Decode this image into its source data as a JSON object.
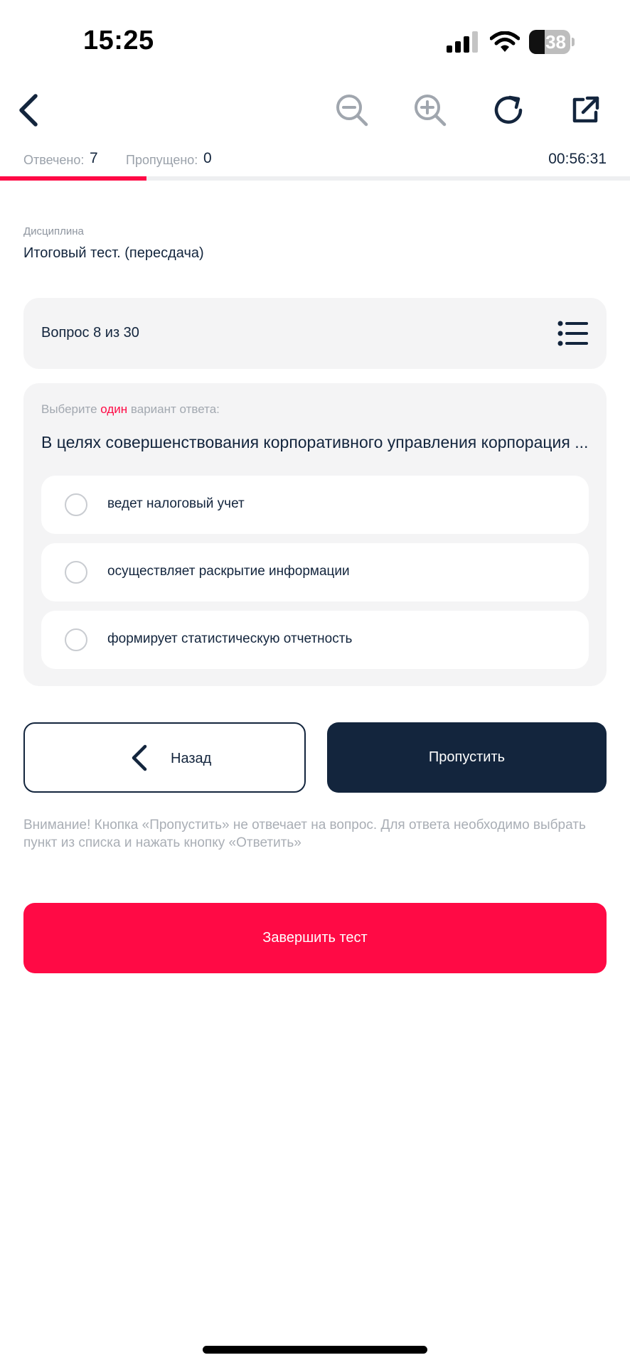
{
  "status_bar": {
    "time": "15:25",
    "battery_level": "38",
    "battery_fraction": 0.38,
    "icons": [
      "cellular-signal-icon",
      "wifi-icon",
      "battery-icon"
    ]
  },
  "toolbar": {
    "icons": [
      "back-chevron-icon",
      "zoom-out-icon",
      "zoom-in-icon",
      "refresh-icon",
      "external-link-icon"
    ]
  },
  "stats": {
    "answered_label": "Отвечено:",
    "answered_value": "7",
    "skipped_label": "Пропущено:",
    "skipped_value": "0",
    "timer": "00:56:31"
  },
  "progress": {
    "fraction": 0.233
  },
  "discipline": {
    "label": "Дисциплина",
    "value": "Итоговый тест. (пересдача)"
  },
  "question": {
    "counter": "Вопрос 8 из 30",
    "instruction_prefix": "Выберите ",
    "instruction_accent": "один",
    "instruction_suffix": " вариант ответа:",
    "text": "В целях совершенствования корпоративного управления корпорация ...",
    "options": [
      {
        "label": "ведет налоговый учет",
        "selected": false
      },
      {
        "label": "осуществляет раскрытие информации",
        "selected": false
      },
      {
        "label": "формирует статистическую отчетность",
        "selected": false
      }
    ]
  },
  "buttons": {
    "back": "Назад",
    "skip": "Пропустить",
    "finish": "Завершить тест"
  },
  "notice": "Внимание! Кнопка «Пропустить» не отвечает на вопрос. Для ответа необходимо выбрать пункт из списка и нажать кнопку «Ответить»",
  "colors": {
    "accent": "#ff0a45",
    "primary_dark": "#13253d",
    "card_bg": "#f4f4f5",
    "muted_text": "#9aa1aa"
  }
}
